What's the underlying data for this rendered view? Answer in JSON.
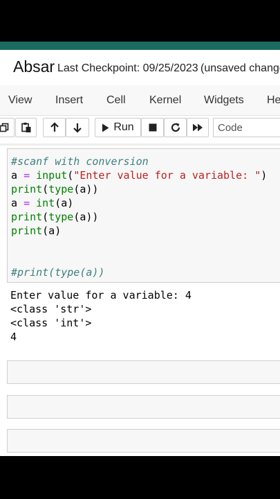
{
  "header": {
    "notebook_name": "Absar",
    "checkpoint": "Last Checkpoint: 09/25/2023",
    "unsaved": "(unsaved change"
  },
  "menu": [
    "View",
    "Insert",
    "Cell",
    "Kernel",
    "Widgets",
    "He"
  ],
  "toolbar": {
    "run_label": "Run",
    "cell_type": "Code",
    "icons": [
      "copy-icon",
      "paste-icon",
      "arrow-up-icon",
      "arrow-down-icon",
      "play-icon",
      "stop-icon",
      "restart-icon",
      "fast-forward-icon"
    ]
  },
  "cell": {
    "line1": "#scanf with conversion",
    "line2_var": "a",
    "line2_op": "=",
    "line2_fn": "input",
    "line2_str": "\"Enter value for a variable: \"",
    "line3_print": "print",
    "line3_type": "type",
    "line3_arg": "(a))",
    "line4_var": "a",
    "line4_op": "=",
    "line4_fn": "int",
    "line4_arg": "(a)",
    "line5_print": "print",
    "line5_type": "type",
    "line5_arg": "(a))",
    "line6_print": "print",
    "line6_arg": "(a)",
    "line9": "#print(type(a))"
  },
  "output": [
    "Enter value for a variable: 4",
    "<class 'str'>",
    "<class 'int'>",
    "4"
  ]
}
